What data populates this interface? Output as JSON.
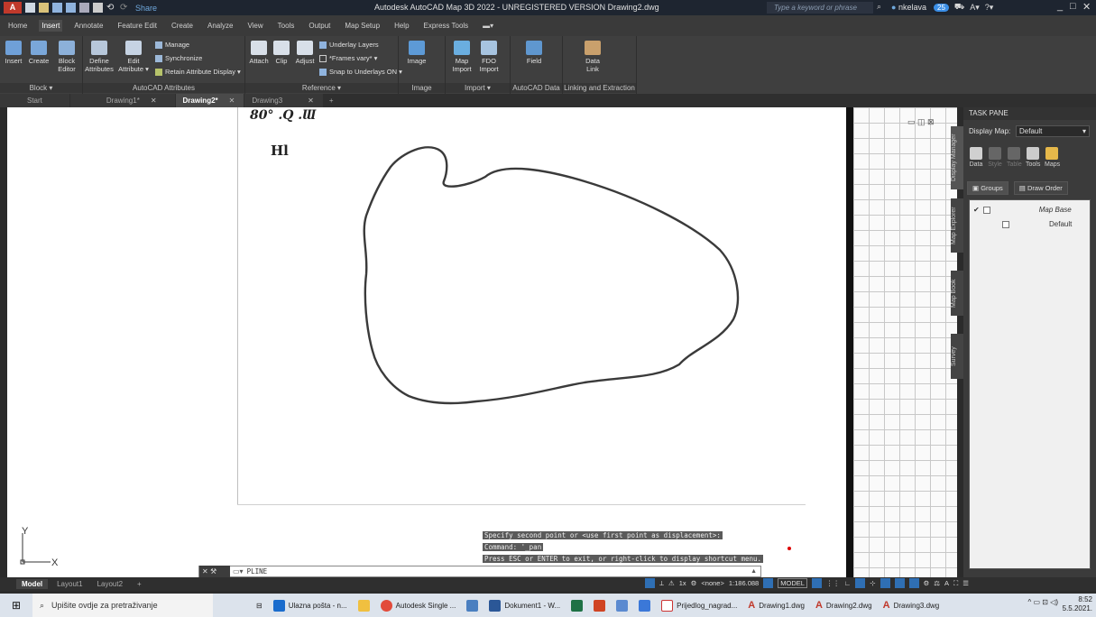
{
  "app": {
    "title": "Autodesk AutoCAD Map 3D 2022 - UNREGISTERED VERSION   Drawing2.dwg",
    "logo": "A",
    "share_label": "Share",
    "search_placeholder": "Type a keyword or phrase",
    "user": "nkelava",
    "badge_count": "25"
  },
  "menu": [
    "Home",
    "Insert",
    "Annotate",
    "Feature Edit",
    "Create",
    "Analyze",
    "View",
    "Tools",
    "Output",
    "Map Setup",
    "Help",
    "Express Tools"
  ],
  "ribbon": {
    "block": {
      "title": "Block ▾",
      "insert": "Insert",
      "create": "Create",
      "editor": "Block Editor"
    },
    "attributes": {
      "title": "AutoCAD Attributes",
      "define": "Define Attributes",
      "edit": "Edit Attribute ▾",
      "manage": "Manage",
      "sync": "Synchronize",
      "retain": "Retain Attribute Display ▾"
    },
    "reference": {
      "title": "Reference ▾",
      "attach": "Attach",
      "clip": "Clip",
      "adjust": "Adjust",
      "underlay": "Underlay Layers",
      "frames": "*Frames vary* ▾",
      "snap": "Snap to Underlays ON ▾"
    },
    "image": {
      "title": "Image",
      "label": "Image"
    },
    "import": {
      "title": "Import ▾",
      "map": "Map Import",
      "fdo": "FDO Import"
    },
    "autocad_data": {
      "title": "AutoCAD Data",
      "field": "Field"
    },
    "linking": {
      "title": "Linking and Extraction",
      "data_link": "Data Link"
    }
  },
  "doc_tabs": [
    {
      "label": "Start",
      "active": false
    },
    {
      "label": "Drawing1*",
      "active": false
    },
    {
      "label": "Drawing2*",
      "active": true
    },
    {
      "label": "Drawing3",
      "active": false
    }
  ],
  "canvas": {
    "handwriting_top": "80° .Q .Ɯ",
    "handwriting_mid": "Hl",
    "ucs_y": "Y",
    "ucs_x": "X",
    "viewport_ctrls": "▭ ◫ ⊠"
  },
  "command": {
    "history": [
      "Specify second point or <use first point as displacement>:",
      "Command: '_pan",
      "Press ESC or ENTER to exit, or right-click to display shortcut menu."
    ],
    "input": "PLINE"
  },
  "taskpane": {
    "title": "TASK PANE",
    "display_map_label": "Display Map:",
    "display_map_value": "Default",
    "tools": [
      "Data",
      "Style",
      "Table",
      "Tools",
      "Maps"
    ],
    "groups_label": "Groups",
    "draw_order_label": "Draw Order",
    "tree": {
      "map_base": "Map Base",
      "default": "Default"
    },
    "vtabs": [
      "Display Manager",
      "Map Explorer",
      "Map Book",
      "Survey"
    ]
  },
  "layout_tabs": [
    "Model",
    "Layout1",
    "Layout2"
  ],
  "status": {
    "scale": "1:186.088",
    "model": "MODEL",
    "none": "<none>",
    "zoom": "1x"
  },
  "taskbar": {
    "search": "Upišite ovdje za pretraživanje",
    "items": [
      "Ulazna pošta - n...",
      "Autodesk Single ...",
      "Dokument1 - W...",
      "Prijedlog_nagrad...",
      "Drawing1.dwg",
      "Drawing2.dwg",
      "Drawing3.dwg"
    ],
    "time": "8:52",
    "date": "5.5.2021."
  },
  "colors": {
    "accent": "#2f6fb4",
    "titlebar": "#1e2530",
    "ribbon": "#3f3f3f"
  }
}
